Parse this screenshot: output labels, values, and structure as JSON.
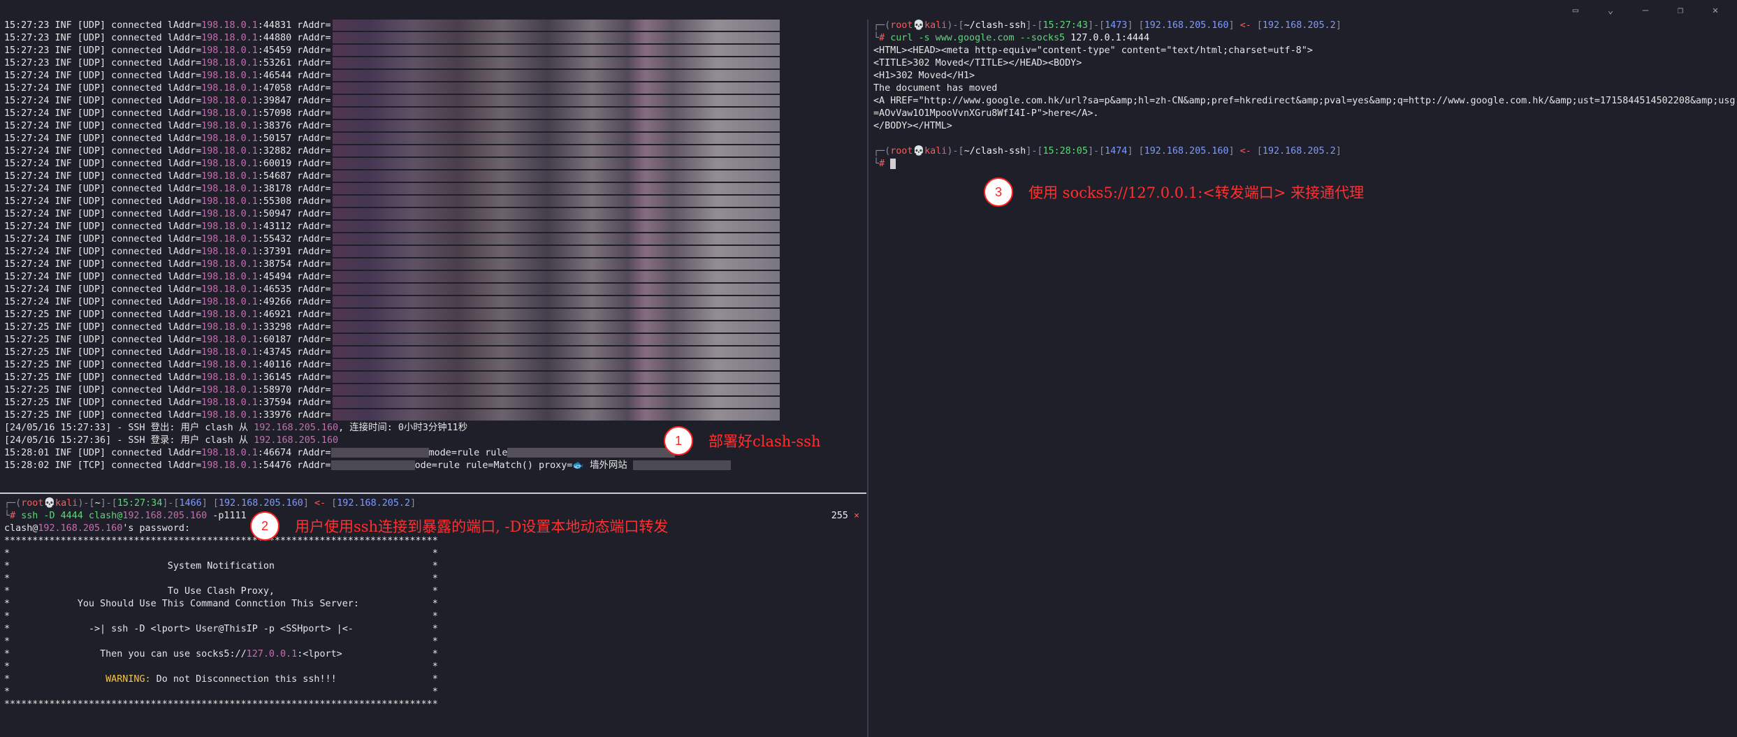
{
  "window_controls": {
    "sidebar": "sidebar-icon",
    "chevron": "⌄",
    "minimize": "—",
    "restore": "❐",
    "close": "✕"
  },
  "left_top": {
    "udp_lines": [
      {
        "t": "15:27:23",
        "p": "44831"
      },
      {
        "t": "15:27:23",
        "p": "44880"
      },
      {
        "t": "15:27:23",
        "p": "45459"
      },
      {
        "t": "15:27:23",
        "p": "53261"
      },
      {
        "t": "15:27:24",
        "p": "46544"
      },
      {
        "t": "15:27:24",
        "p": "47058"
      },
      {
        "t": "15:27:24",
        "p": "39847"
      },
      {
        "t": "15:27:24",
        "p": "57098"
      },
      {
        "t": "15:27:24",
        "p": "38376"
      },
      {
        "t": "15:27:24",
        "p": "50157"
      },
      {
        "t": "15:27:24",
        "p": "32882"
      },
      {
        "t": "15:27:24",
        "p": "60019"
      },
      {
        "t": "15:27:24",
        "p": "54687"
      },
      {
        "t": "15:27:24",
        "p": "38178"
      },
      {
        "t": "15:27:24",
        "p": "55308"
      },
      {
        "t": "15:27:24",
        "p": "50947"
      },
      {
        "t": "15:27:24",
        "p": "43112"
      },
      {
        "t": "15:27:24",
        "p": "55432"
      },
      {
        "t": "15:27:24",
        "p": "37391"
      },
      {
        "t": "15:27:24",
        "p": "38754"
      },
      {
        "t": "15:27:24",
        "p": "45494"
      },
      {
        "t": "15:27:24",
        "p": "46535"
      },
      {
        "t": "15:27:24",
        "p": "49266"
      },
      {
        "t": "15:27:25",
        "p": "46921"
      },
      {
        "t": "15:27:25",
        "p": "33298"
      },
      {
        "t": "15:27:25",
        "p": "60187"
      },
      {
        "t": "15:27:25",
        "p": "43745"
      },
      {
        "t": "15:27:25",
        "p": "40116"
      },
      {
        "t": "15:27:25",
        "p": "36145"
      },
      {
        "t": "15:27:25",
        "p": "58970"
      },
      {
        "t": "15:27:25",
        "p": "37594"
      },
      {
        "t": "15:27:25",
        "p": "33976"
      }
    ],
    "inf_prefix": " INF [UDP] connected lAddr=",
    "local_ip": "198.18.0.1",
    "raddr": " rAddr=",
    "ssh_logout_prefix": "[24/05/16 15:27:33] - SSH 登出: 用户 clash 从 ",
    "ssh_ip": "192.168.205.160",
    "ssh_logout_suffix": ", 连接时间: 0小时3分钟11秒",
    "ssh_login_prefix": "[24/05/16 15:27:36] - SSH 登录: 用户 clash 从 ",
    "last_udp": "15:28:01 INF [UDP] connected lAddr=",
    "last_udp_port": ":46674",
    "last_udp_mode": "mode=rule rule",
    "last_tcp": "15:28:02 INF [TCP] connected lAddr=",
    "last_tcp_port": ":54476",
    "last_tcp_mode": "ode=rule rule=Match() proxy=",
    "last_tcp_emoji": "🐟",
    "last_tcp_site": " 墙外网站 ",
    "annotation_num": "1",
    "annotation_text": "部署好clash-ssh"
  },
  "left_bottom": {
    "prompt_user": "root",
    "prompt_host": "kali",
    "prompt_dir": "~",
    "prompt_time": "15:27:34",
    "prompt_num": "1466",
    "prompt_ip_from": "192.168.205.160",
    "prompt_ip_to": "192.168.205.2",
    "command": "ssh -D 4444 clash@",
    "command_ip": "192.168.205.160",
    "command_suffix": " -p1111",
    "exit_code": "255",
    "exit_mark": "×",
    "pw_prefix": "clash@",
    "pw_suffix": "'s password:",
    "banner_border": "*****************************************************************************",
    "banner_title": "System Notification",
    "banner_line1": "To Use Clash Proxy,",
    "banner_line2": "You Should Use This Command Connction This Server:",
    "banner_cmd": "->| ssh -D <lport> User@ThisIP -p <SSHport> |<-",
    "banner_then_prefix": "Then you can use socks5://",
    "banner_then_ip": "127.0.0.1",
    "banner_then_suffix": ":<lport>",
    "banner_warn_label": "WARNING:",
    "banner_warn_text": " Do not Disconnection this ssh!!!",
    "annotation_num": "2",
    "annotation_text": "用户使用ssh连接到暴露的端口, -D设置本地动态端口转发"
  },
  "right": {
    "prompt1_time": "15:27:43",
    "prompt1_num": "1473",
    "prompt_dir": "~/clash-ssh",
    "prompt_ip_from": "192.168.205.160",
    "prompt_ip_to": "192.168.205.2",
    "cmd": "curl -s www.google.com --socks5 ",
    "cmd_ip": "127.0.0.1:4444",
    "out1": "<HTML><HEAD><meta http-equiv=\"content-type\" content=\"text/html;charset=utf-8\">",
    "out2": "<TITLE>302 Moved</TITLE></HEAD><BODY>",
    "out3": "<H1>302 Moved</H1>",
    "out4": "The document has moved",
    "out5": "<A HREF=\"http://www.google.com.hk/url?sa=p&amp;hl=zh-CN&amp;pref=hkredirect&amp;pval=yes&amp;q=http://www.google.com.hk/&amp;ust=1715844514502208&amp;usg",
    "out6": "=AOvVaw1O1MpooVvnXGru8WfI4I-P\">here</A>.",
    "out7": "</BODY></HTML>",
    "prompt2_time": "15:28:05",
    "prompt2_num": "1474",
    "annotation_num": "3",
    "annotation_text": "使用  socks5://127.0.0.1:<转发端口>  来接通代理"
  }
}
